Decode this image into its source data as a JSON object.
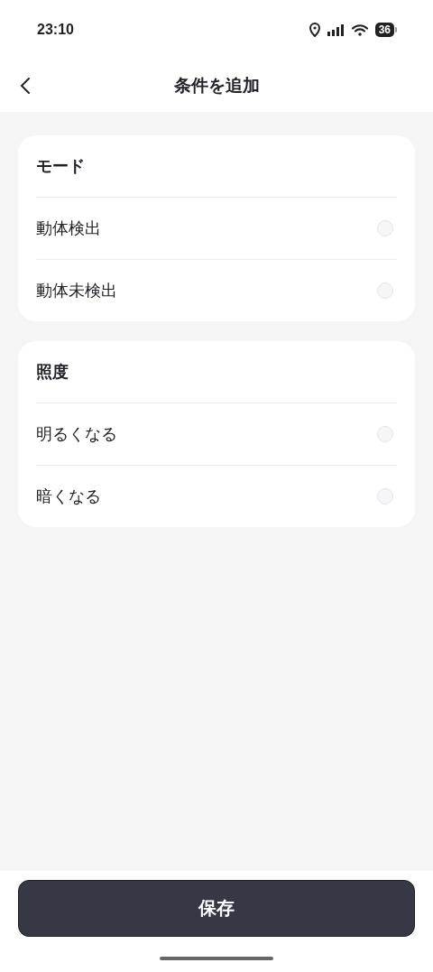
{
  "status_bar": {
    "time": "23:10",
    "battery": "36"
  },
  "header": {
    "title": "条件を追加"
  },
  "sections": [
    {
      "title": "モード",
      "options": [
        {
          "label": "動体検出",
          "selected": false
        },
        {
          "label": "動体未検出",
          "selected": false
        }
      ]
    },
    {
      "title": "照度",
      "options": [
        {
          "label": "明るくなる",
          "selected": false
        },
        {
          "label": "暗くなる",
          "selected": false
        }
      ]
    }
  ],
  "save_button": "保存"
}
